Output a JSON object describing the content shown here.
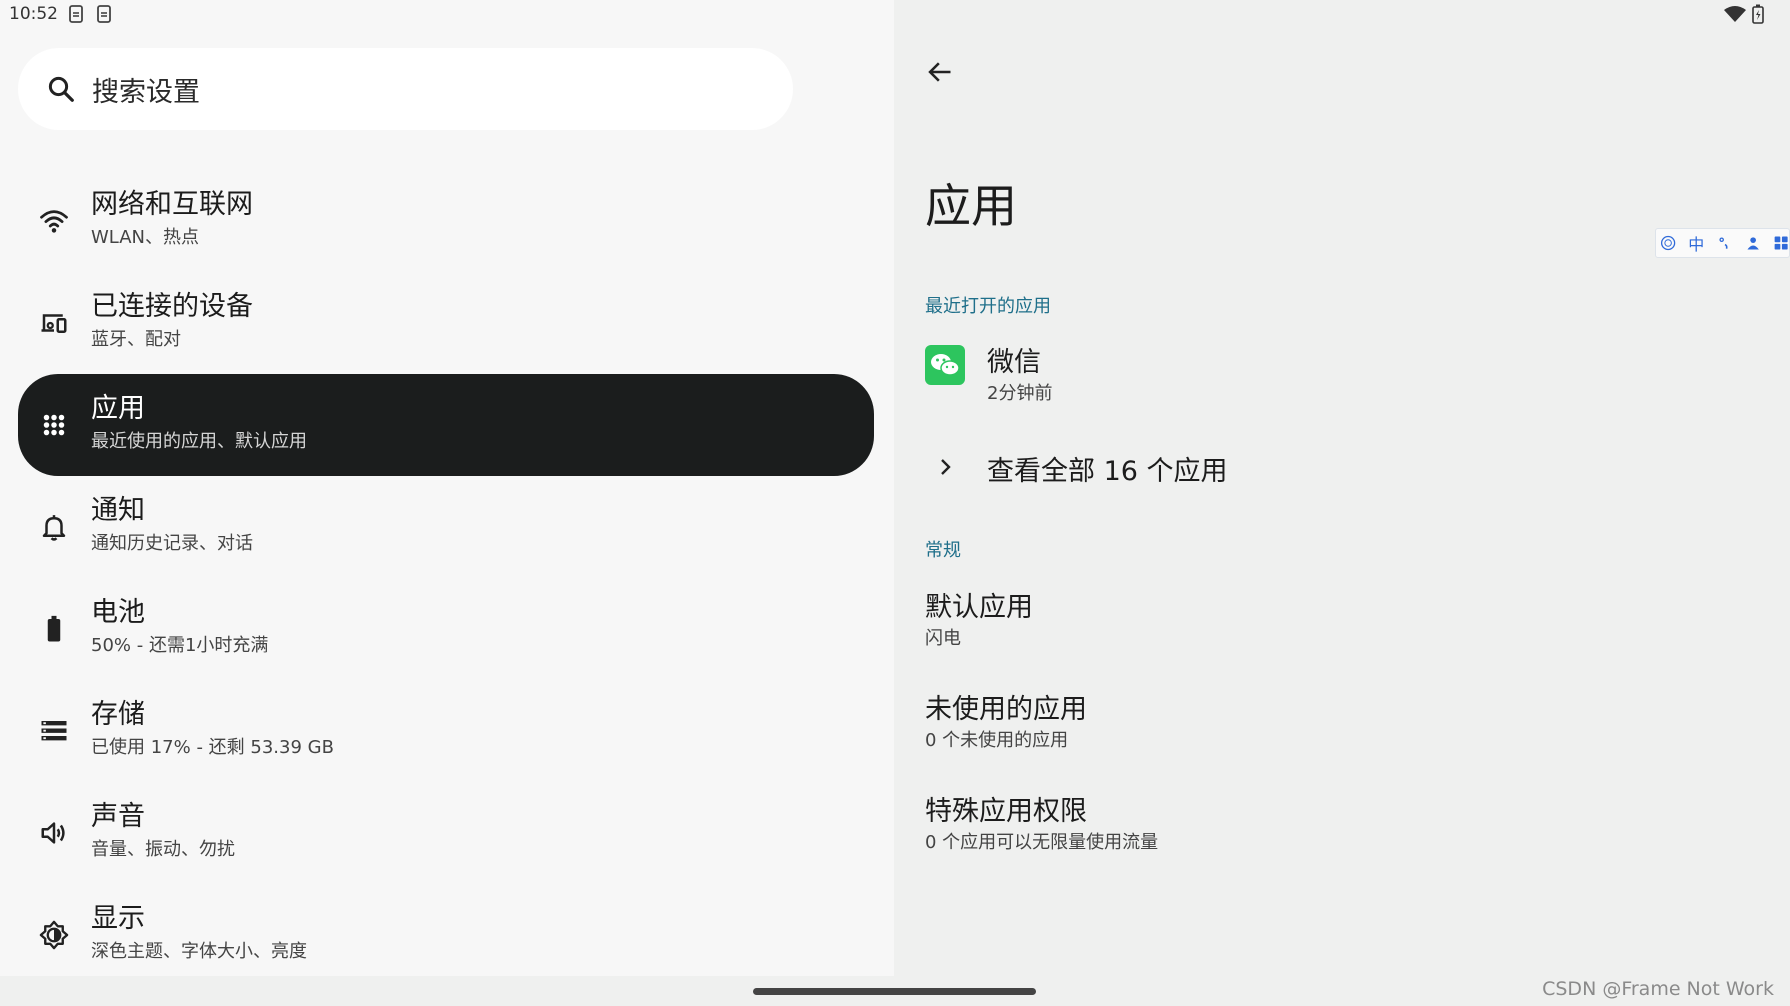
{
  "status_bar": {
    "time": "10:52"
  },
  "search": {
    "placeholder": "搜索设置"
  },
  "menu": [
    {
      "title": "网络和互联网",
      "sub": "WLAN、热点",
      "icon": "wifi-icon"
    },
    {
      "title": "已连接的设备",
      "sub": "蓝牙、配对",
      "icon": "devices-icon"
    },
    {
      "title": "应用",
      "sub": "最近使用的应用、默认应用",
      "icon": "apps-icon",
      "active": true
    },
    {
      "title": "通知",
      "sub": "通知历史记录、对话",
      "icon": "bell-icon"
    },
    {
      "title": "电池",
      "sub": "50% - 还需1小时充满",
      "icon": "battery-icon"
    },
    {
      "title": "存储",
      "sub": "已使用 17% - 还剩 53.39 GB",
      "icon": "storage-icon"
    },
    {
      "title": "声音",
      "sub": "音量、振动、勿扰",
      "icon": "volume-icon"
    },
    {
      "title": "显示",
      "sub": "深色主题、字体大小、亮度",
      "icon": "brightness-icon"
    }
  ],
  "detail": {
    "title": "应用",
    "recent_header": "最近打开的应用",
    "recent_app": {
      "title": "微信",
      "sub": "2分钟前"
    },
    "see_all": "查看全部 16 个应用",
    "general_header": "常规",
    "settings": [
      {
        "title": "默认应用",
        "sub": "闪电"
      },
      {
        "title": "未使用的应用",
        "sub": "0 个未使用的应用"
      },
      {
        "title": "特殊应用权限",
        "sub": "0 个应用可以无限量使用流量"
      }
    ]
  },
  "ime": {
    "lang": "中"
  },
  "watermark": "CSDN @Frame Not Work",
  "colors": {
    "active_bg": "#1b1d1d",
    "accent": "#1f6f8a",
    "wechat_green": "#2dc55e"
  }
}
